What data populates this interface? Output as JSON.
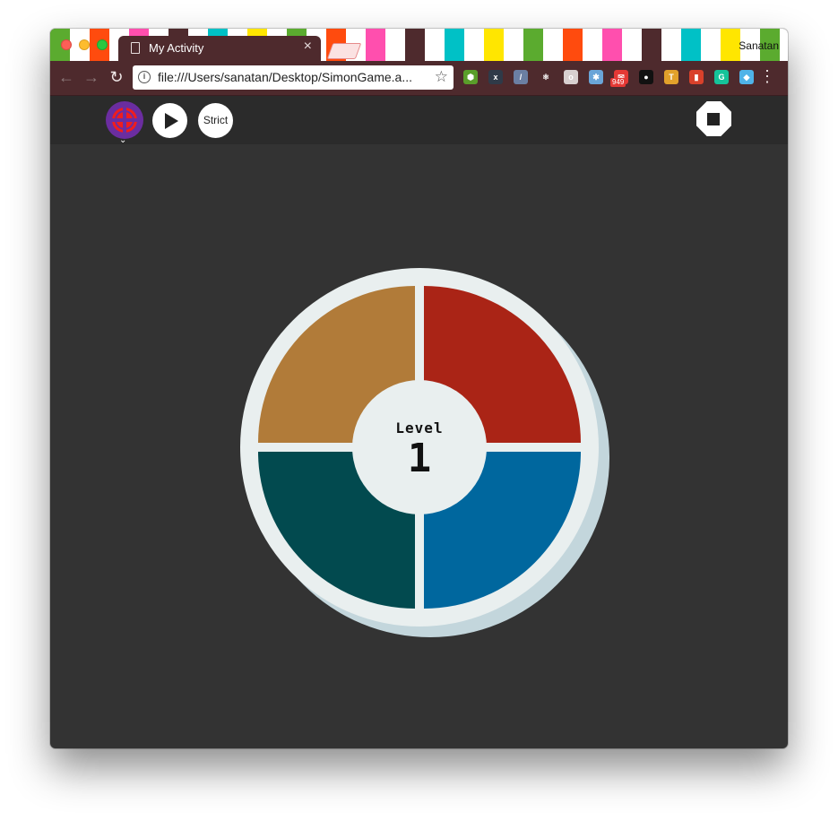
{
  "browser": {
    "tab_title": "My Activity",
    "tab_close": "×",
    "profile_name": "Sanatan",
    "url": "file:///Users/sanatan/Desktop/SimonGame.a...",
    "back_icon": "←",
    "forward_icon": "→",
    "reload_icon": "↻",
    "star_icon": "☆",
    "menu_icon": "⋮",
    "info_icon": "i",
    "extension_badge": "949",
    "extensions": [
      {
        "name": "extension-icon-1",
        "color": "#5a9e2a",
        "glyph": "⬢"
      },
      {
        "name": "extension-icon-2",
        "color": "#2f3a48",
        "glyph": "x"
      },
      {
        "name": "extension-icon-3",
        "color": "#6b7fa3",
        "glyph": "/"
      },
      {
        "name": "react-icon",
        "color": "#4e2a2d",
        "glyph": "⚛"
      },
      {
        "name": "extension-icon-5",
        "color": "#d8d0d0",
        "glyph": "o"
      },
      {
        "name": "extension-icon-6",
        "color": "#6aa5d8",
        "glyph": "✱"
      },
      {
        "name": "mail-icon",
        "color": "#e53935",
        "glyph": "✉"
      },
      {
        "name": "color-picker-icon",
        "color": "#111111",
        "glyph": "●"
      },
      {
        "name": "txt-icon",
        "color": "#e2a12b",
        "glyph": "T"
      },
      {
        "name": "book-icon",
        "color": "#d9412b",
        "glyph": "▮"
      },
      {
        "name": "grammarly-icon",
        "color": "#15c39a",
        "glyph": "G"
      },
      {
        "name": "diamond-icon",
        "color": "#4fb3e8",
        "glyph": "◆"
      }
    ]
  },
  "app": {
    "strict_label": "Strict",
    "level_label": "Level",
    "level_value": "1"
  },
  "colors": {
    "tab_stripes": [
      "#5bab2f",
      "#ffffff",
      "#ff4b0e",
      "#ffffff",
      "#ff4fae",
      "#ffffff",
      "#4e2a2d",
      "#ffffff",
      "#00c1c6",
      "#ffffff",
      "#ffe600",
      "#ffffff",
      "#5bab2f",
      "#ffffff",
      "#ff4b0e",
      "#ffffff",
      "#ff4fae",
      "#ffffff",
      "#4e2a2d",
      "#ffffff",
      "#00c1c6",
      "#ffffff",
      "#ffe600",
      "#ffffff",
      "#5bab2f",
      "#ffffff",
      "#ff4b0e",
      "#ffffff",
      "#ff4fae",
      "#ffffff",
      "#4e2a2d",
      "#ffffff",
      "#00c1c6",
      "#ffffff",
      "#ffe600",
      "#ffffff",
      "#5bab2f",
      "#ffffff"
    ],
    "quad_top_left": "#b17b39",
    "quad_top_right": "#aa2416",
    "quad_bottom_left": "#024a4f",
    "quad_bottom_right": "#00679e"
  }
}
